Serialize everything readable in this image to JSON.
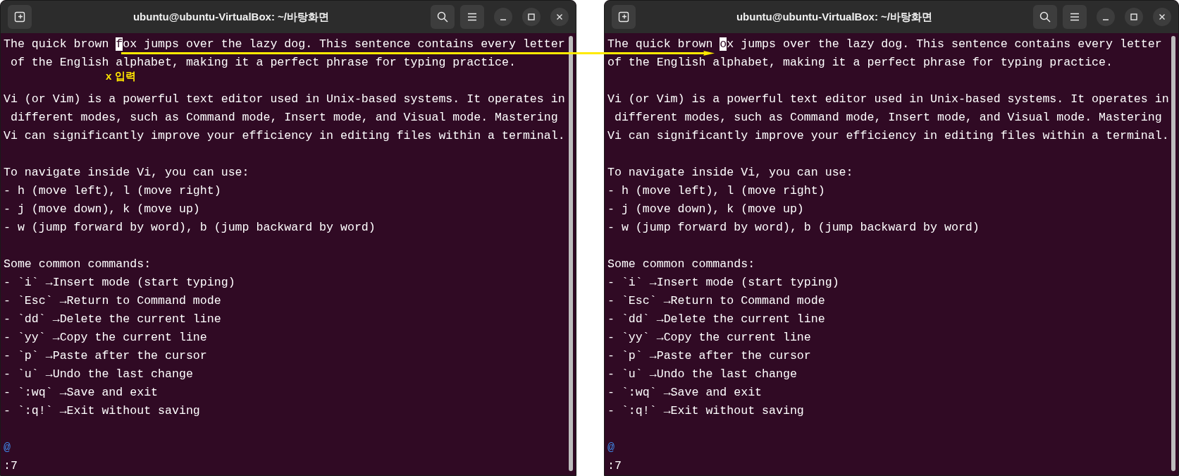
{
  "windows": [
    {
      "title": "ubuntu@ubuntu-VirtualBox: ~/바탕화면",
      "lines": [
        {
          "kind": "cursor",
          "before": "The quick brown ",
          "cursor": "f",
          "after": "ox jumps over the lazy dog. This sentence contains every letter"
        },
        {
          "kind": "text",
          "text": " of the English alphabet, making it a perfect phrase for typing practice."
        },
        {
          "kind": "blank"
        },
        {
          "kind": "text",
          "text": "Vi (or Vim) is a powerful text editor used in Unix-based systems. It operates in"
        },
        {
          "kind": "text",
          "text": " different modes, such as Command mode, Insert mode, and Visual mode. Mastering"
        },
        {
          "kind": "text",
          "text": "Vi can significantly improve your efficiency in editing files within a terminal."
        },
        {
          "kind": "blank"
        },
        {
          "kind": "text",
          "text": "To navigate inside Vi, you can use:"
        },
        {
          "kind": "text",
          "text": "- h (move left), l (move right)"
        },
        {
          "kind": "text",
          "text": "- j (move down), k (move up)"
        },
        {
          "kind": "text",
          "text": "- w (jump forward by word), b (jump backward by word)"
        },
        {
          "kind": "blank"
        },
        {
          "kind": "text",
          "text": "Some common commands:"
        },
        {
          "kind": "text",
          "text": "- `i` →Insert mode (start typing)"
        },
        {
          "kind": "text",
          "text": "- `Esc` →Return to Command mode"
        },
        {
          "kind": "text",
          "text": "- `dd` →Delete the current line"
        },
        {
          "kind": "text",
          "text": "- `yy` →Copy the current line"
        },
        {
          "kind": "text",
          "text": "- `p` →Paste after the cursor"
        },
        {
          "kind": "text",
          "text": "- `u` →Undo the last change"
        },
        {
          "kind": "text",
          "text": "- `:wq` →Save and exit"
        },
        {
          "kind": "text",
          "text": "- `:q!` →Exit without saving"
        },
        {
          "kind": "blank"
        },
        {
          "kind": "filler",
          "text": "@"
        },
        {
          "kind": "command",
          "text": ":7"
        }
      ]
    },
    {
      "title": "ubuntu@ubuntu-VirtualBox: ~/바탕화면",
      "lines": [
        {
          "kind": "cursor",
          "before": "The quick brown ",
          "cursor": "o",
          "after": "x jumps over the lazy dog. This sentence contains every letter"
        },
        {
          "kind": "text",
          "text": "of the English alphabet, making it a perfect phrase for typing practice."
        },
        {
          "kind": "blank"
        },
        {
          "kind": "text",
          "text": "Vi (or Vim) is a powerful text editor used in Unix-based systems. It operates in"
        },
        {
          "kind": "text",
          "text": " different modes, such as Command mode, Insert mode, and Visual mode. Mastering"
        },
        {
          "kind": "text",
          "text": "Vi can significantly improve your efficiency in editing files within a terminal."
        },
        {
          "kind": "blank"
        },
        {
          "kind": "text",
          "text": "To navigate inside Vi, you can use:"
        },
        {
          "kind": "text",
          "text": "- h (move left), l (move right)"
        },
        {
          "kind": "text",
          "text": "- j (move down), k (move up)"
        },
        {
          "kind": "text",
          "text": "- w (jump forward by word), b (jump backward by word)"
        },
        {
          "kind": "blank"
        },
        {
          "kind": "text",
          "text": "Some common commands:"
        },
        {
          "kind": "text",
          "text": "- `i` →Insert mode (start typing)"
        },
        {
          "kind": "text",
          "text": "- `Esc` →Return to Command mode"
        },
        {
          "kind": "text",
          "text": "- `dd` →Delete the current line"
        },
        {
          "kind": "text",
          "text": "- `yy` →Copy the current line"
        },
        {
          "kind": "text",
          "text": "- `p` →Paste after the cursor"
        },
        {
          "kind": "text",
          "text": "- `u` →Undo the last change"
        },
        {
          "kind": "text",
          "text": "- `:wq` →Save and exit"
        },
        {
          "kind": "text",
          "text": "- `:q!` →Exit without saving"
        },
        {
          "kind": "blank"
        },
        {
          "kind": "filler",
          "text": "@"
        },
        {
          "kind": "command",
          "text": ":7"
        }
      ]
    }
  ],
  "annotation": {
    "label": "x 입력"
  }
}
